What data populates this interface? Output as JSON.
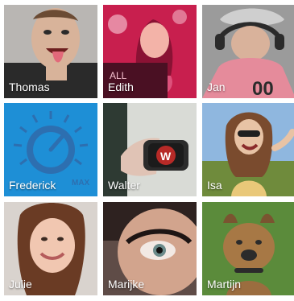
{
  "tiles": [
    {
      "name": "Thomas",
      "kind": "photo",
      "colors": [
        "#b9b6b3",
        "#2a2a2a",
        "#d8b39a"
      ]
    },
    {
      "name": "Edith",
      "kind": "photo",
      "colors": [
        "#c81f4e",
        "#ee7aa0",
        "#f6c1cf"
      ]
    },
    {
      "name": "Jan",
      "kind": "photo",
      "colors": [
        "#9b9b9b",
        "#e58b9b",
        "#2b2b2b"
      ]
    },
    {
      "name": "Frederick",
      "kind": "app-icon",
      "colors": [
        "#1e8fd6",
        "#2d6fb0",
        "#ffffff"
      ],
      "icon": "volume-knob-icon",
      "icon_text": "MAX"
    },
    {
      "name": "Walter",
      "kind": "app-icon",
      "colors": [
        "#d9dbd6",
        "#2e3a33",
        "#b72a27"
      ],
      "icon": "wilson-logo-icon",
      "icon_text": "W"
    },
    {
      "name": "Isa",
      "kind": "photo",
      "colors": [
        "#8fb7df",
        "#e9c879",
        "#6f8b3c"
      ]
    },
    {
      "name": "Julie",
      "kind": "photo",
      "colors": [
        "#d9d3ce",
        "#6a3b24",
        "#f1c7b1"
      ]
    },
    {
      "name": "Marijke",
      "kind": "photo",
      "colors": [
        "#5f4c47",
        "#2e2220",
        "#d2a48d"
      ]
    },
    {
      "name": "Martijn",
      "kind": "photo",
      "colors": [
        "#5b8b3b",
        "#a77845",
        "#2b2b2b"
      ]
    }
  ]
}
